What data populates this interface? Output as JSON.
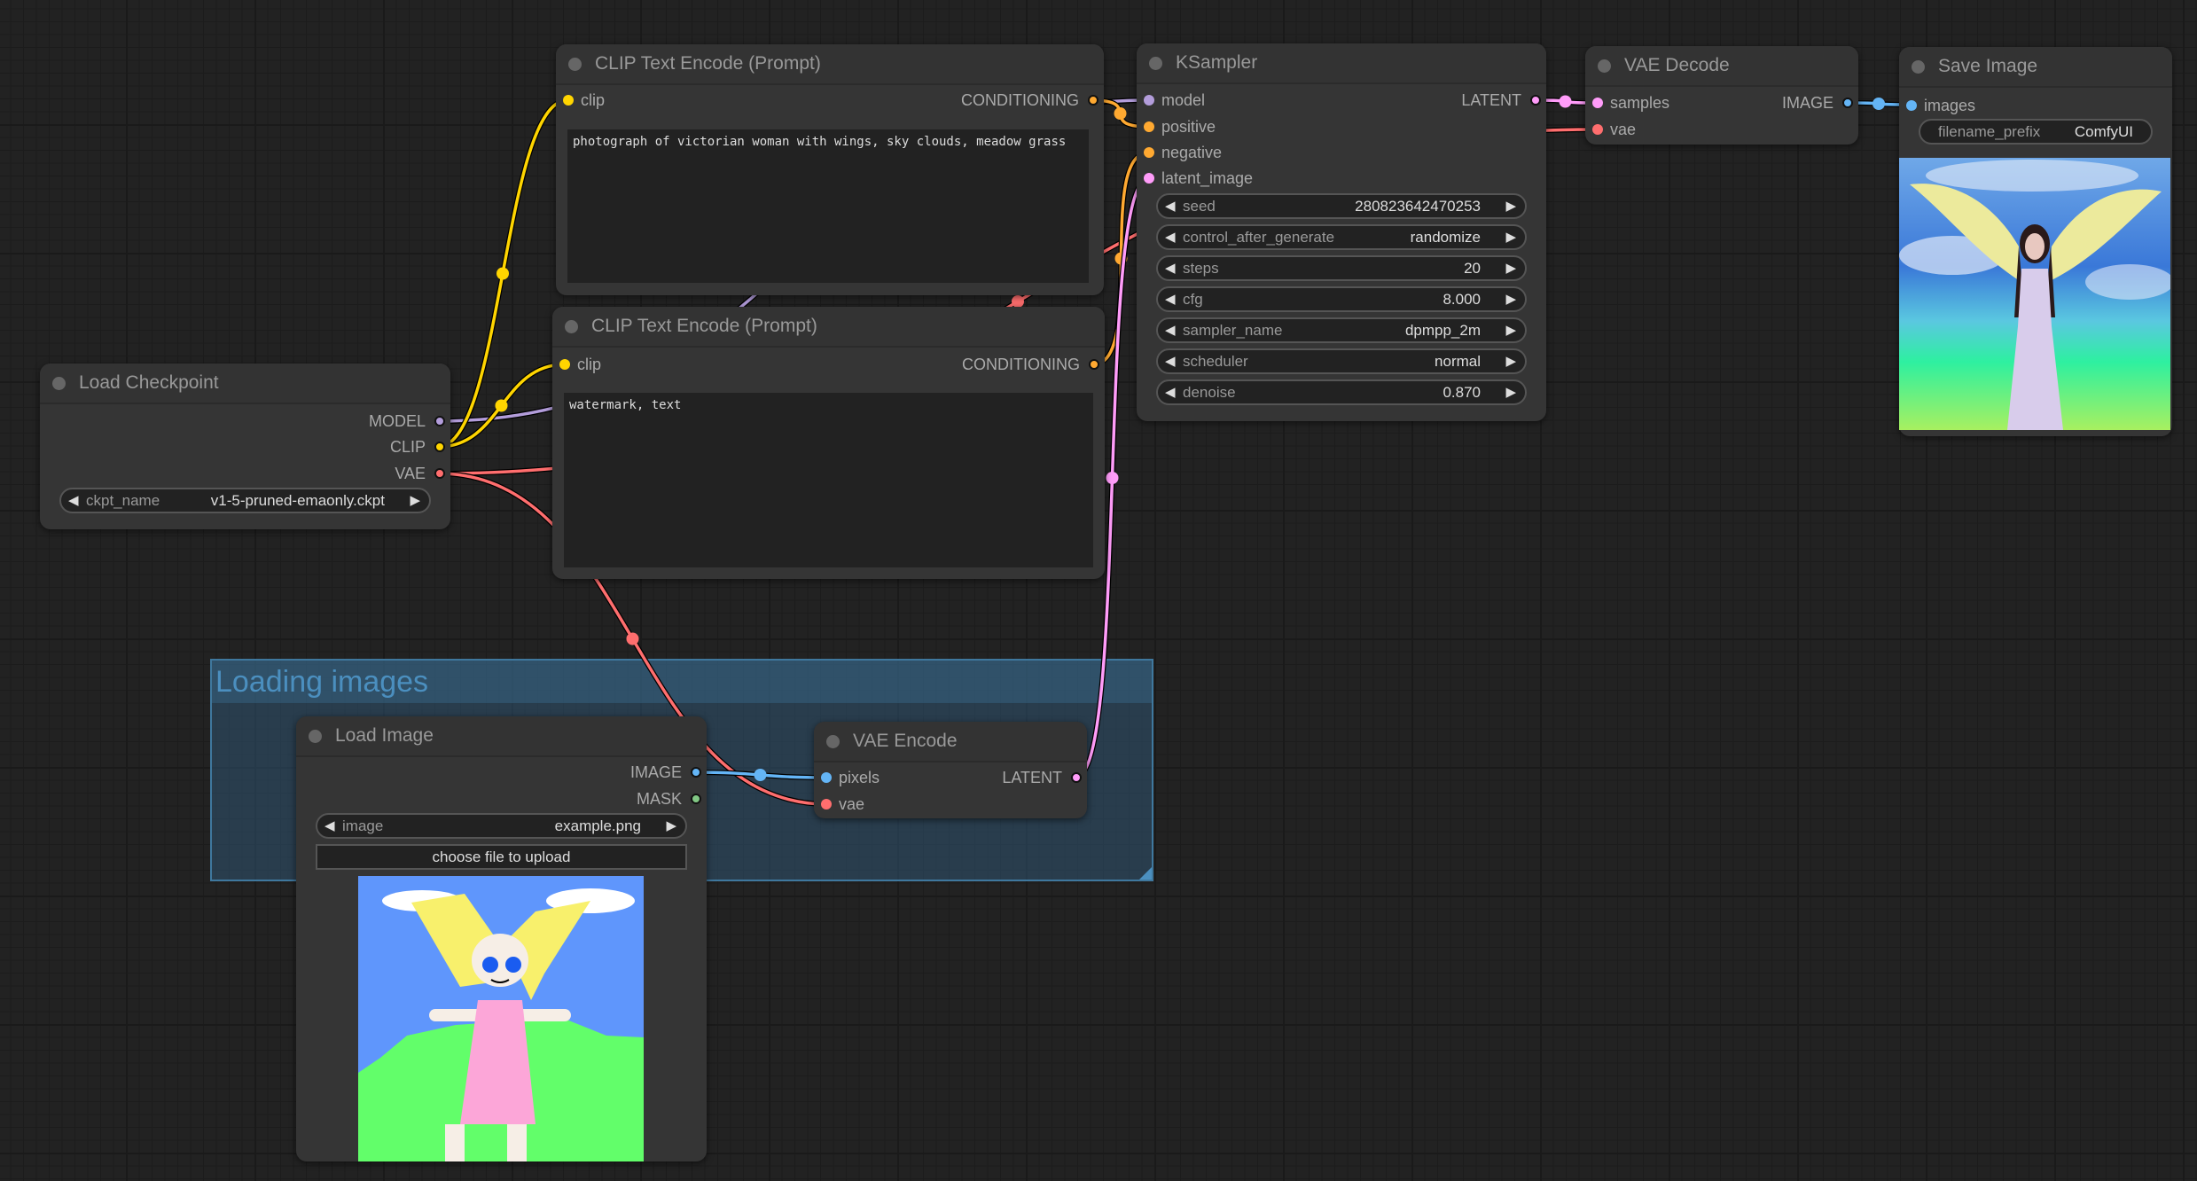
{
  "colors": {
    "model": "#b39ddb",
    "clip": "#ffd500",
    "vae": "#ff6e6e",
    "conditioning": "#ffa931",
    "latent": "#ff9cf9",
    "image": "#64b5f6",
    "mask": "#81c784"
  },
  "group": {
    "title": "Loading images"
  },
  "load_checkpoint": {
    "title": "Load Checkpoint",
    "outputs": [
      "MODEL",
      "CLIP",
      "VAE"
    ],
    "widget": {
      "label": "ckpt_name",
      "value": "v1-5-pruned-emaonly.ckpt"
    }
  },
  "clip_pos": {
    "title": "CLIP Text Encode (Prompt)",
    "input": "clip",
    "output": "CONDITIONING",
    "text": "photograph of victorian woman with wings, sky clouds, meadow grass"
  },
  "clip_neg": {
    "title": "CLIP Text Encode (Prompt)",
    "input": "clip",
    "output": "CONDITIONING",
    "text": "watermark, text"
  },
  "ksampler": {
    "title": "KSampler",
    "inputs": [
      "model",
      "positive",
      "negative",
      "latent_image"
    ],
    "output": "LATENT",
    "widgets": [
      {
        "label": "seed",
        "value": "280823642470253"
      },
      {
        "label": "control_after_generate",
        "value": "randomize"
      },
      {
        "label": "steps",
        "value": "20"
      },
      {
        "label": "cfg",
        "value": "8.000"
      },
      {
        "label": "sampler_name",
        "value": "dpmpp_2m"
      },
      {
        "label": "scheduler",
        "value": "normal"
      },
      {
        "label": "denoise",
        "value": "0.870"
      }
    ]
  },
  "vae_decode": {
    "title": "VAE Decode",
    "inputs": [
      "samples",
      "vae"
    ],
    "output": "IMAGE"
  },
  "save_image": {
    "title": "Save Image",
    "input": "images",
    "widget": {
      "label": "filename_prefix",
      "value": "ComfyUI"
    },
    "preview": "generated image of winged woman in lavender dress against sky and green meadow"
  },
  "load_image": {
    "title": "Load Image",
    "outputs": [
      "IMAGE",
      "MASK"
    ],
    "widget": {
      "label": "image",
      "value": "example.png"
    },
    "upload_label": "choose file to upload",
    "preview": "child's drawing of a girl with yellow wings in a pink dress"
  },
  "vae_encode": {
    "title": "VAE Encode",
    "inputs": [
      "pixels",
      "vae"
    ],
    "output": "LATENT"
  },
  "arrows": {
    "left": "◀",
    "right": "▶"
  }
}
